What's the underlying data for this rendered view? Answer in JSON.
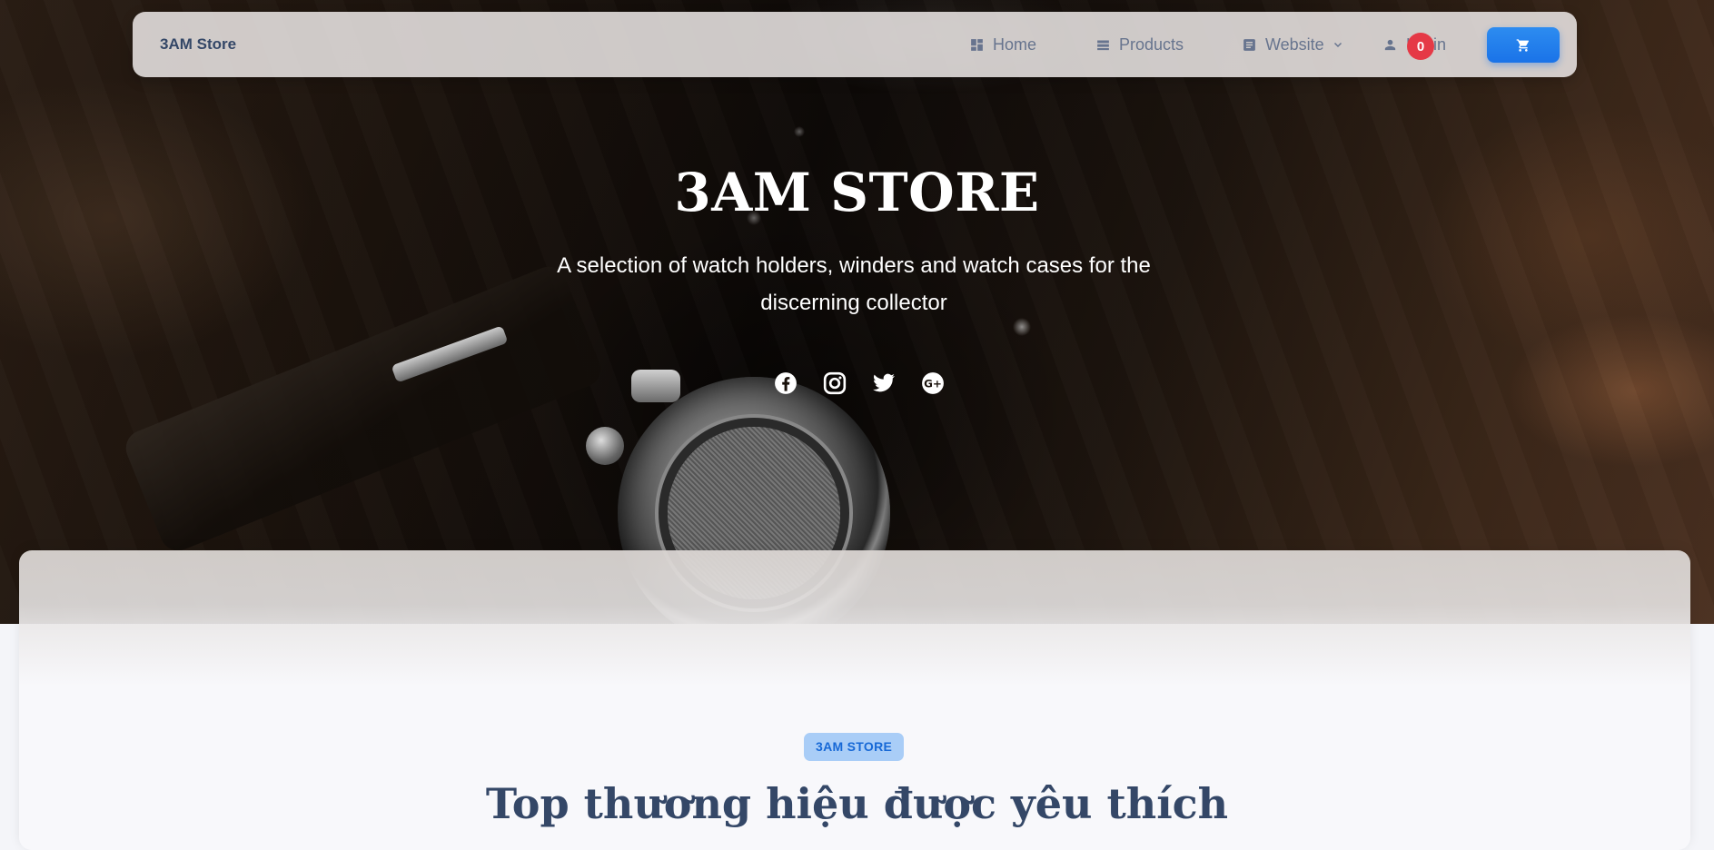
{
  "navbar": {
    "brand": "3AM Store",
    "items": [
      {
        "label": "Home",
        "icon": "dashboard-icon"
      },
      {
        "label": "Products",
        "icon": "view-list-icon"
      },
      {
        "label": "Website",
        "icon": "article-icon"
      },
      {
        "label": "Login",
        "icon": "person-icon"
      }
    ],
    "cart_count": "0"
  },
  "hero": {
    "title": "3AM STORE",
    "subtitle": "A selection of watch holders, winders and watch cases for the discerning collector",
    "socials": [
      "facebook-icon",
      "instagram-icon",
      "twitter-icon",
      "google-plus-icon"
    ]
  },
  "section": {
    "badge": "3AM STORE",
    "title": "Top thương hiệu được yêu thích"
  },
  "colors": {
    "accent": "#1a73e8",
    "badge_bg": "#e53946",
    "heading": "#344767",
    "nav_text": "#67748e"
  }
}
